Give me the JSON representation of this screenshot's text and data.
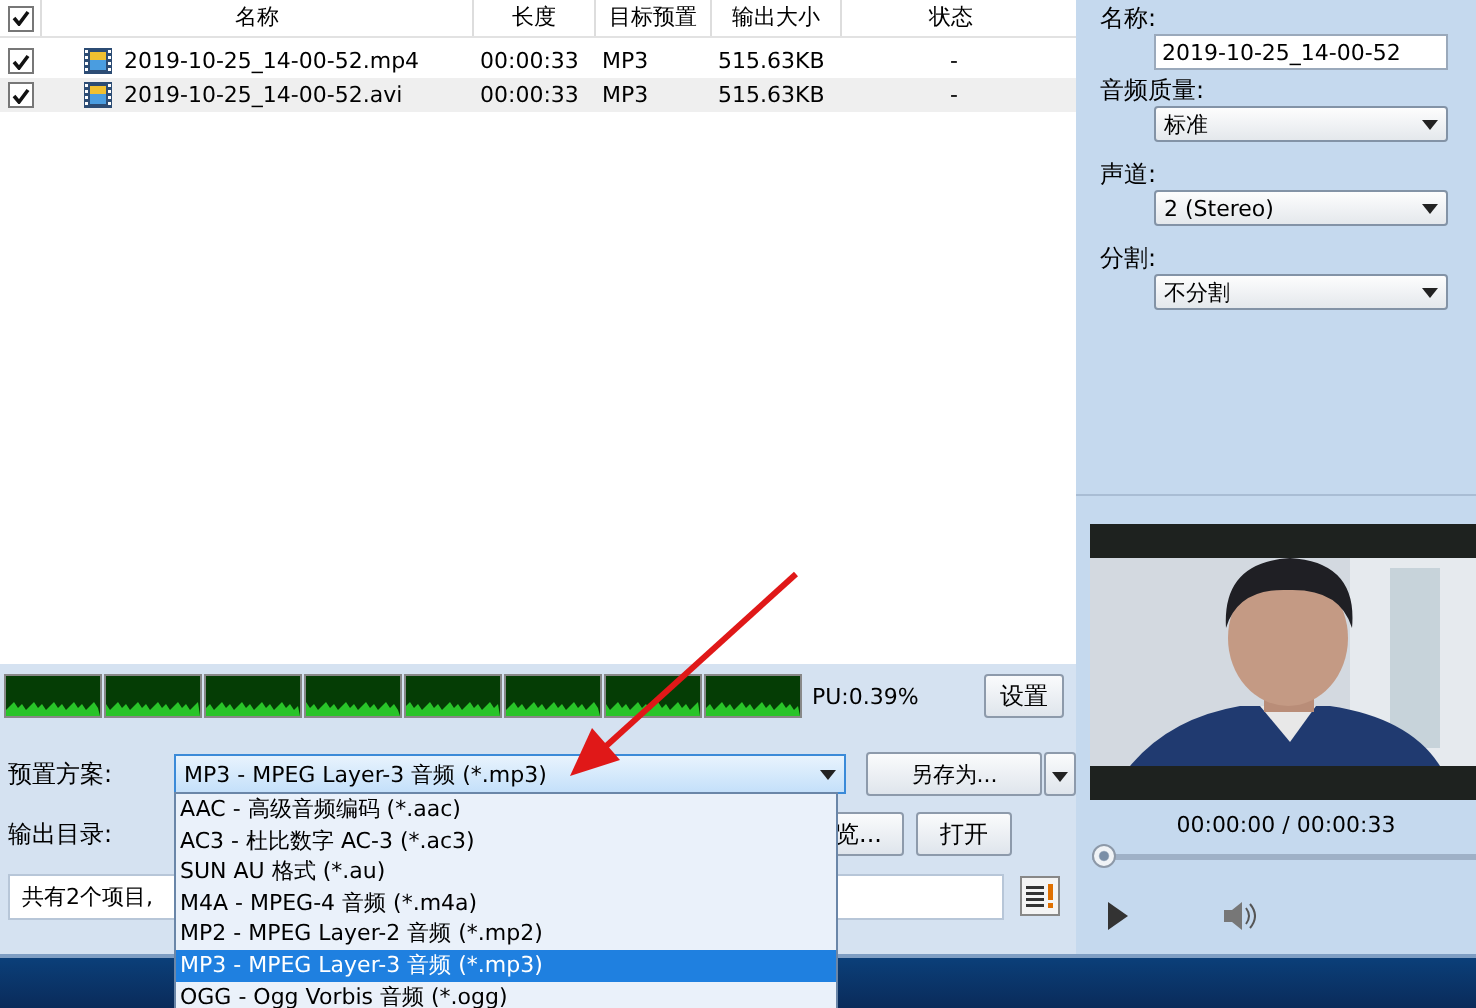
{
  "file_list": {
    "header_checked": true,
    "columns": [
      "名称",
      "长度",
      "目标预置",
      "输出大小",
      "状态"
    ],
    "rows": [
      {
        "checked": true,
        "selected": false,
        "name": "2019-10-25_14-00-52.mp4",
        "length": "00:00:33",
        "preset": "MP3",
        "size": "515.63KB",
        "status": "-"
      },
      {
        "checked": true,
        "selected": true,
        "name": "2019-10-25_14-00-52.avi",
        "length": "00:00:33",
        "preset": "MP3",
        "size": "515.63KB",
        "status": "-"
      }
    ]
  },
  "cpu_text": "PU:0.39%",
  "settings_button": "设置",
  "preset": {
    "label": "预置方案:",
    "value": "MP3 - MPEG Layer-3 音频 (*.mp3)",
    "save_as": "另存为...",
    "expanded": true,
    "options": [
      {
        "label": "AAC - 高级音频编码 (*.aac)",
        "selected": false
      },
      {
        "label": "AC3 - 杜比数字 AC-3 (*.ac3)",
        "selected": false
      },
      {
        "label": "SUN AU 格式 (*.au)",
        "selected": false
      },
      {
        "label": "M4A - MPEG-4 音频 (*.m4a)",
        "selected": false
      },
      {
        "label": "MP2 - MPEG Layer-2 音频 (*.mp2)",
        "selected": false
      },
      {
        "label": "MP3 - MPEG Layer-3 音频 (*.mp3)",
        "selected": true
      },
      {
        "label": "OGG - Ogg Vorbis 音频 (*.ogg)",
        "selected": false
      }
    ]
  },
  "output": {
    "label": "输出目录:",
    "browse": "览...",
    "open": "打开"
  },
  "status": {
    "text": "共有2个项目,"
  },
  "properties": [
    {
      "kind": "text",
      "label": "名称:",
      "value": "2019-10-25_14-00-52"
    },
    {
      "kind": "select",
      "label": "音频质量:",
      "value": "标准"
    },
    {
      "kind": "select",
      "label": "声道:",
      "value": "2 (Stereo)"
    },
    {
      "kind": "select",
      "label": "分割:",
      "value": "不分割"
    }
  ],
  "player": {
    "time": "00:00:00 / 00:00:33",
    "level": 0.0
  }
}
